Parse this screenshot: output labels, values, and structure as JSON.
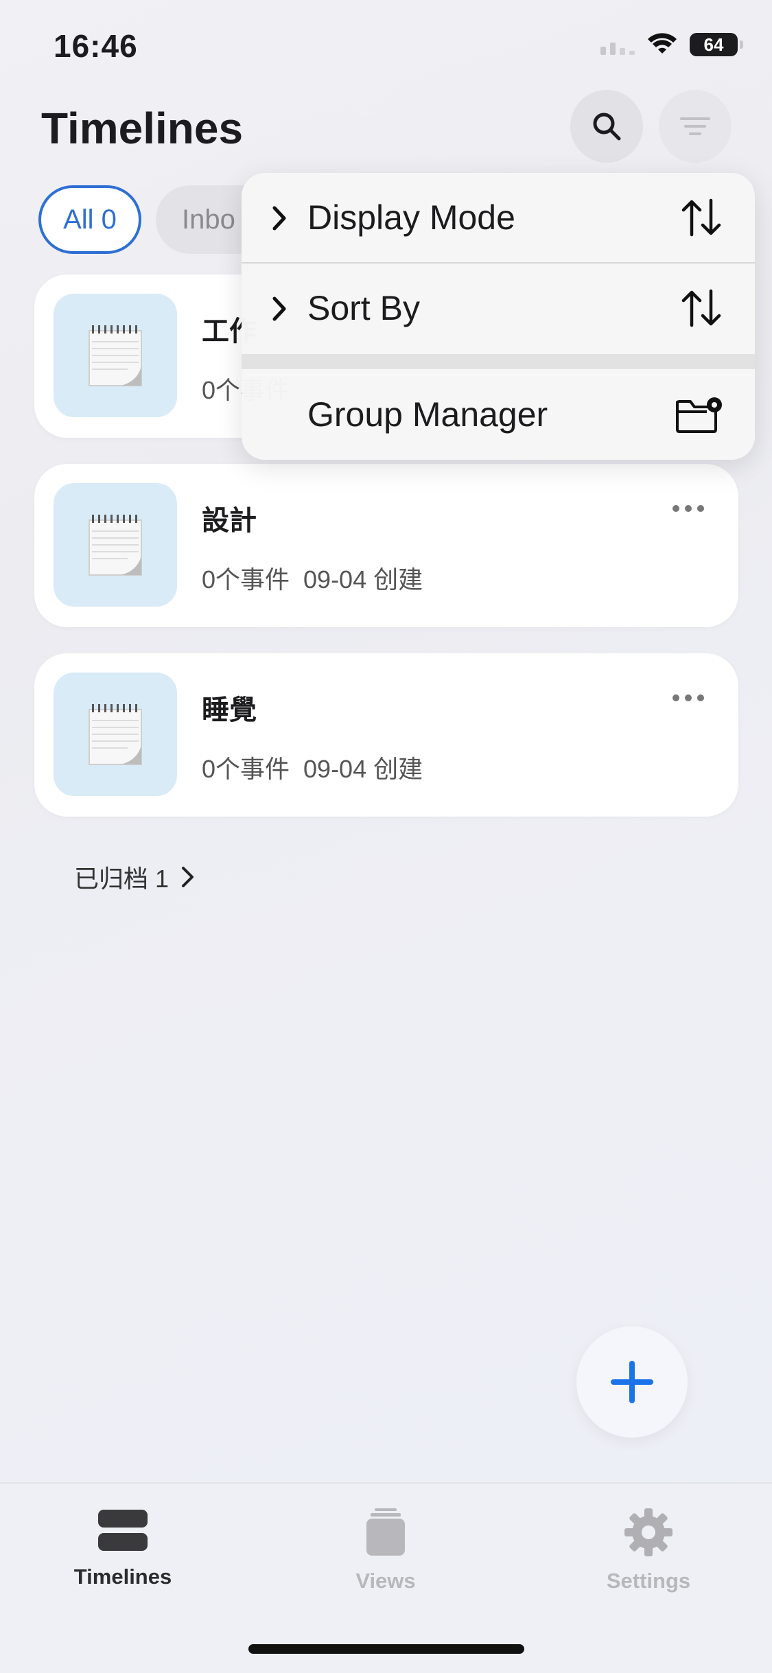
{
  "status_bar": {
    "time": "16:46",
    "battery": "64"
  },
  "header": {
    "title": "Timelines"
  },
  "tabs": [
    {
      "label": "All 0",
      "selected": true
    },
    {
      "label": "Inbo",
      "selected": false
    }
  ],
  "timelines": [
    {
      "title": "工作",
      "meta": "0个事件"
    },
    {
      "title": "設計",
      "meta": "0个事件  09-04 创建"
    },
    {
      "title": "睡覺",
      "meta": "0个事件  09-04 创建"
    }
  ],
  "archived": {
    "label": "已归档 1"
  },
  "menu": {
    "items": [
      {
        "label": "Display Mode",
        "icon": "sort-arrows-icon"
      },
      {
        "label": "Sort By",
        "icon": "sort-arrows-icon"
      },
      {
        "label": "Group Manager",
        "icon": "folder-gear-icon"
      }
    ]
  },
  "tab_bar": {
    "items": [
      {
        "label": "Timelines",
        "icon": "stack-icon",
        "active": true
      },
      {
        "label": "Views",
        "icon": "cards-icon",
        "active": false
      },
      {
        "label": "Settings",
        "icon": "gear-icon",
        "active": false
      }
    ]
  },
  "colors": {
    "accent": "#2f6fd3",
    "fab_plus": "#1a73e8",
    "thumb_bg": "#d9ebf7"
  }
}
